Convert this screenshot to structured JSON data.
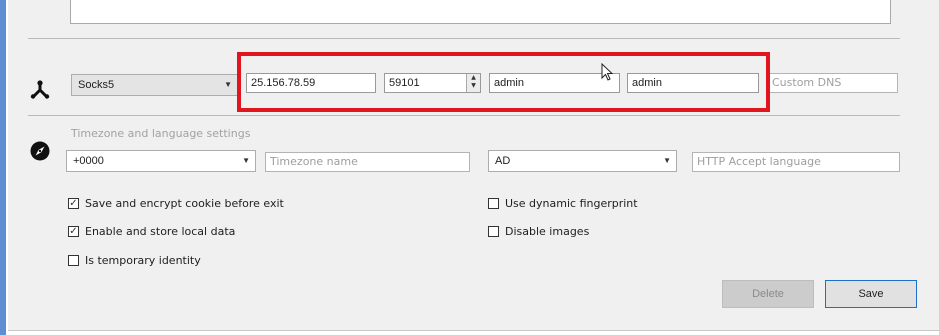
{
  "proxy": {
    "type": "Socks5",
    "host": "25.156.78.59",
    "port": "59101",
    "username": "admin",
    "password": "admin",
    "custom_dns_placeholder": "Custom DNS"
  },
  "timezone_language": {
    "section_title": "Timezone and language settings",
    "timezone_offset": "+0000",
    "timezone_name_placeholder": "Timezone name",
    "language_code": "AD",
    "accept_language_placeholder": "HTTP Accept language"
  },
  "options": {
    "save_cookie": {
      "label": "Save and encrypt cookie before exit",
      "checked": true
    },
    "local_data": {
      "label": "Enable and store local data",
      "checked": true
    },
    "temporary_identity": {
      "label": "Is temporary identity",
      "checked": false
    },
    "dynamic_fingerprint": {
      "label": "Use dynamic fingerprint",
      "checked": false
    },
    "disable_images": {
      "label": "Disable images",
      "checked": false
    }
  },
  "actions": {
    "delete_label": "Delete",
    "save_label": "Save"
  },
  "colors": {
    "highlight": "#e0161e",
    "primary_border": "#1e6fc8"
  },
  "icons": {
    "proxy": "network-nodes-icon",
    "timezone": "compass-icon",
    "cursor": "mouse-pointer-icon"
  }
}
